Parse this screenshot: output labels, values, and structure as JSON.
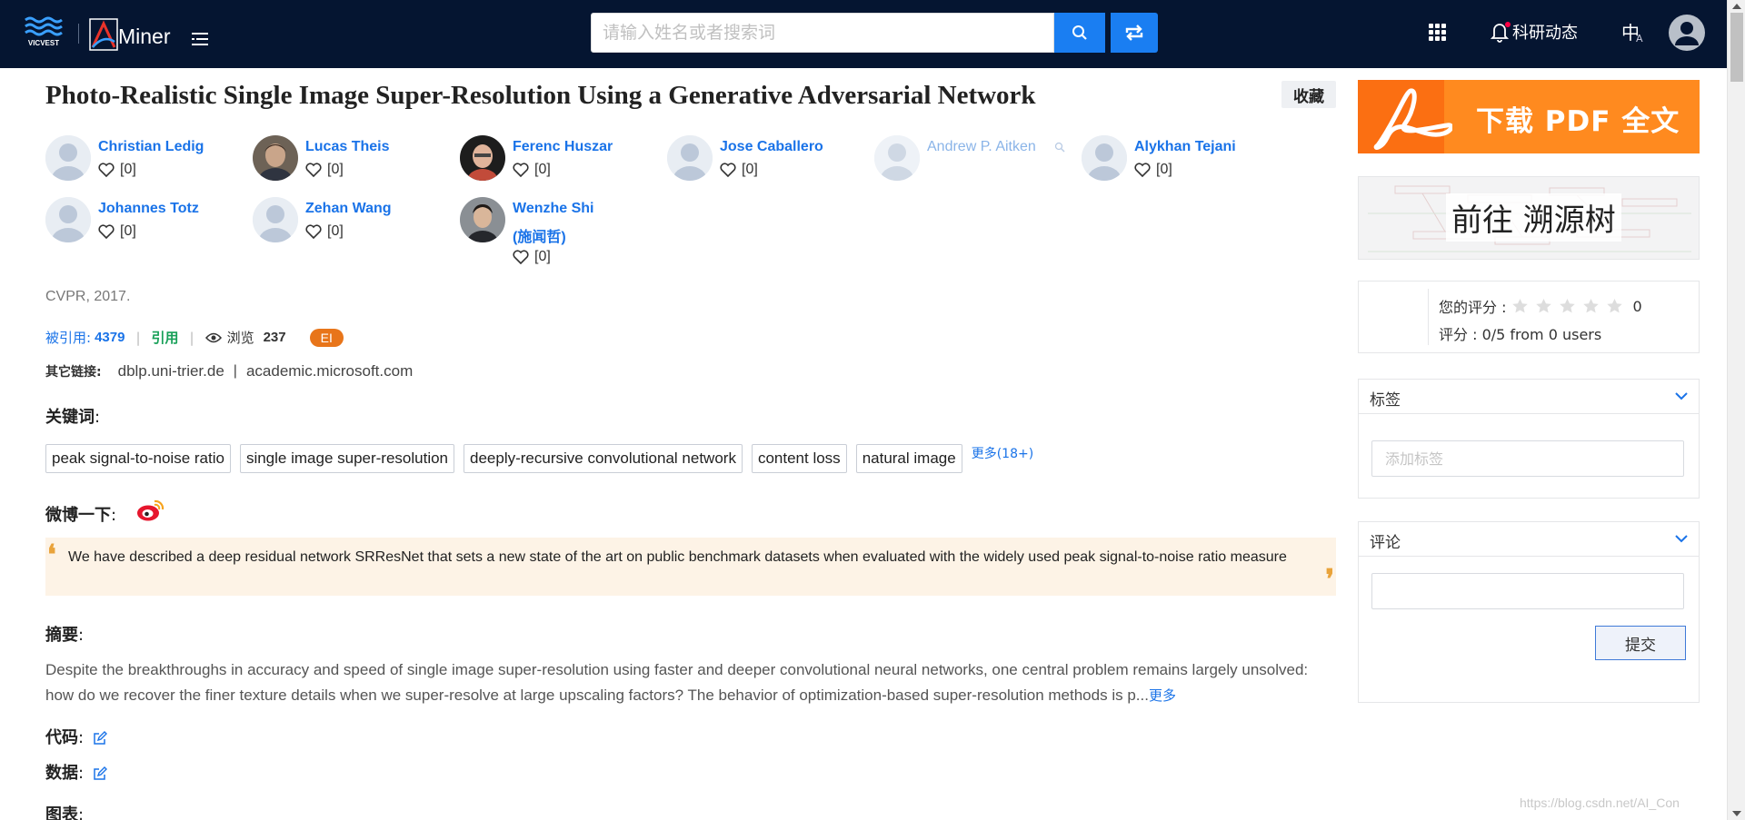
{
  "header": {
    "logo_text": "VICVEST",
    "brand": "Miner",
    "search_placeholder": "请输入姓名或者搜索词",
    "news_label": "科研动态",
    "lang_label": "中",
    "lang_sub": "A",
    "bg_color": "#051531",
    "accent": "#1a7ef2"
  },
  "paper": {
    "title": "Photo-Realistic Single Image Super-Resolution Using a Generative Adversarial Network",
    "favorite_label": "收藏",
    "authors": [
      {
        "name": "Christian Ledig",
        "likes": "[0]",
        "avatar": "placeholder"
      },
      {
        "name": "Lucas Theis",
        "likes": "[0]",
        "avatar": "photo"
      },
      {
        "name": "Ferenc Huszar",
        "likes": "[0]",
        "avatar": "photo"
      },
      {
        "name": "Jose Caballero",
        "likes": "[0]",
        "avatar": "placeholder"
      },
      {
        "name": "Andrew P. Aitken",
        "likes": "",
        "avatar": "placeholder"
      },
      {
        "name": "Alykhan Tejani",
        "likes": "[0]",
        "avatar": "placeholder"
      },
      {
        "name": "Johannes Totz",
        "likes": "[0]",
        "avatar": "placeholder"
      },
      {
        "name": "Zehan Wang",
        "likes": "[0]",
        "avatar": "placeholder"
      },
      {
        "name": "Wenzhe Shi",
        "name_cn": "(施闻哲)",
        "likes": "[0]",
        "avatar": "photo"
      }
    ],
    "venue": "CVPR, 2017.",
    "cited_label": "被引用:",
    "cited_count": "4379",
    "cite_label": "引用",
    "views_label": "浏览",
    "views_count": "237",
    "badge": "EI",
    "other_links_label": "其它链接:",
    "other_links": [
      "dblp.uni-trier.de",
      "academic.microsoft.com"
    ],
    "keywords_label": "关键词",
    "keywords": [
      "peak signal-to-noise ratio",
      "single image super-resolution",
      "deeply-recursive convolutional network",
      "content loss",
      "natural image"
    ],
    "keywords_more": "更多(18+)",
    "weibo_label": "微博一下",
    "quote": "We have described a deep residual network SRResNet that sets a new state of the art on public benchmark datasets when evaluated with the widely used peak signal-to-noise ratio measure",
    "abstract_label": "摘要",
    "abstract": "Despite the breakthroughs in accuracy and speed of single image super-resolution using faster and deeper convolutional neural networks, one central problem remains largely unsolved: how do we recover the finer texture details when we super-resolve at large upscaling factors? The behavior of optimization-based super-resolution methods is p...",
    "abstract_more": "更多",
    "code_label": "代码",
    "data_label": "数据",
    "figures_label": "图表"
  },
  "sidebar": {
    "pdf_label": "下载 PDF 全文",
    "trace_label": "前往 溯源树",
    "rating_label": "您的评分 :",
    "rating_value": "0",
    "rating_summary": "评分 : 0/5 from 0 users",
    "stars_total": 5,
    "stars_filled": 0,
    "tags_title": "标签",
    "tags_placeholder": "添加标签",
    "comments_title": "评论",
    "submit_label": "提交"
  },
  "watermark": "https://blog.csdn.net/AI_Con"
}
